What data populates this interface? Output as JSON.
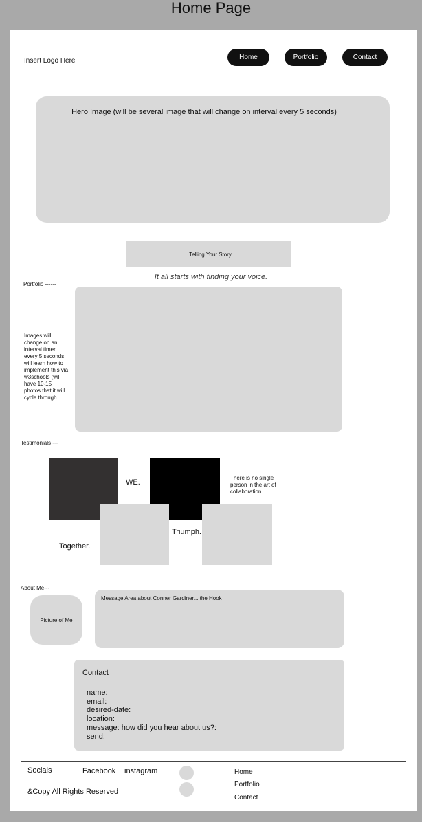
{
  "page_title": "Home Page",
  "header": {
    "logo_text": "Insert Logo Here",
    "nav": [
      "Home",
      "Portfolio",
      "Contact"
    ]
  },
  "hero": {
    "text": "Hero Image (will be several image that will change on interval every 5 seconds)"
  },
  "story": {
    "heading": "Telling Your Story",
    "tagline": "It all starts with finding your voice."
  },
  "portfolio": {
    "label": "Portfolio ------",
    "note": "Images will change on an interval timer every 5 seconds, will learn how to implement this via w3schools (will have 10-15 photos that it will cycle through."
  },
  "testimonials": {
    "label": "Testimonials ---",
    "we": "WE.",
    "quote": "There is no single person in the art of collaboration.",
    "together": "Together.",
    "triumph": "Triumph."
  },
  "about": {
    "label": "About Me---",
    "picture_text": "Picture of Me",
    "message": "Message Area about Conner Gardiner... the Hook"
  },
  "contact": {
    "title": "Contact",
    "fields": [
      "name:",
      "email:",
      "desired-date:",
      "location:",
      "message: how did you hear about us?:",
      "send:"
    ]
  },
  "footer": {
    "socials_label": "Socials",
    "facebook": "Facebook",
    "instagram": "instagram",
    "copyright": "&Copy All Rights Reserved",
    "nav": [
      "Home",
      "Portfolio",
      "Contact"
    ]
  },
  "colors": {
    "outer_background": "#a9a9a9",
    "placeholder_grey": "#d9d9d9",
    "nav_button": "#111111"
  }
}
